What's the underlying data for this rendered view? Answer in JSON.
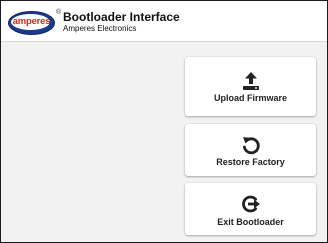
{
  "header": {
    "logo_text": "amperes",
    "logo_mark": "®",
    "title": "Bootloader Interface",
    "subtitle": "Amperes Electronics"
  },
  "actions": [
    {
      "label": "Upload Firmware",
      "icon": "upload-icon"
    },
    {
      "label": "Restore Factory",
      "icon": "restore-icon"
    },
    {
      "label": "Exit Bootloader",
      "icon": "exit-icon"
    }
  ],
  "colors": {
    "brand_blue": "#1c3a8c",
    "brand_red": "#d8261f",
    "background": "#f2f2f2",
    "card": "#ffffff",
    "icon": "#222222"
  }
}
